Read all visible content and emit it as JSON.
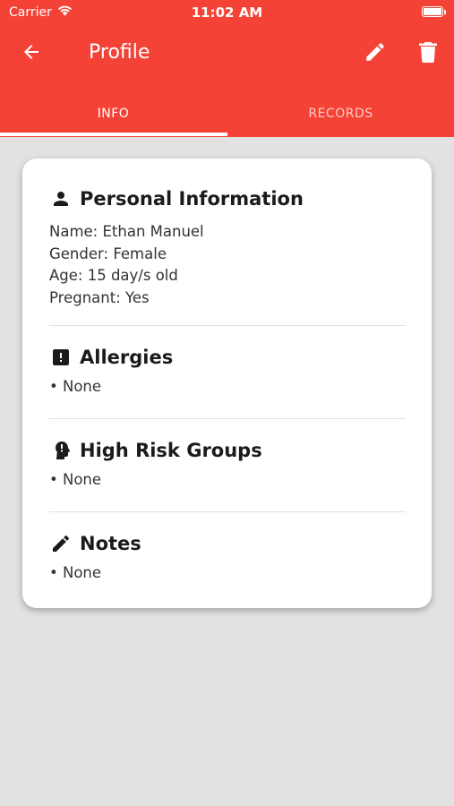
{
  "status_bar": {
    "carrier": "Carrier",
    "time": "11:02 AM"
  },
  "app_bar": {
    "title": "Profile",
    "color": "#f44336",
    "icons": [
      "back-arrow-icon",
      "pencil-icon",
      "trash-icon"
    ]
  },
  "tabs": [
    {
      "label": "INFO",
      "selected": true
    },
    {
      "label": "RECORDS",
      "selected": false
    }
  ],
  "profile": {
    "personal": {
      "title": "Personal Information",
      "name_line": "Name: Ethan Manuel",
      "gender_line": "Gender: Female",
      "age_line": "Age: 15 day/s old",
      "pregnant_line": "Pregnant: Yes"
    },
    "allergies": {
      "title": "Allergies",
      "items": [
        "• None"
      ]
    },
    "high_risk": {
      "title": "High Risk Groups",
      "items": [
        "• None"
      ]
    },
    "notes": {
      "title": "Notes",
      "items": [
        "• None"
      ]
    }
  }
}
